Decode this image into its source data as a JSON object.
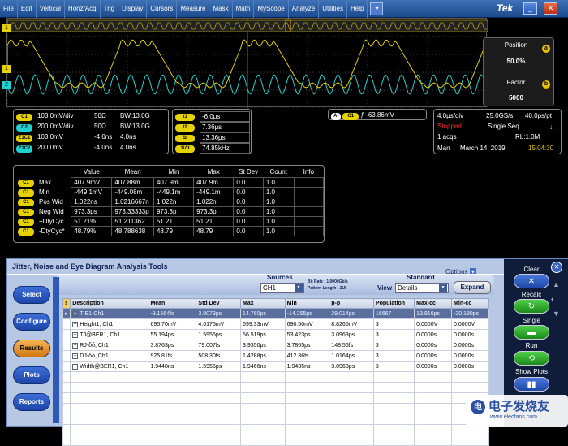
{
  "menu": {
    "items": [
      "File",
      "Edit",
      "Vertical",
      "Horiz/Acq",
      "Trig",
      "Display",
      "Cursors",
      "Measure",
      "Mask",
      "Math",
      "MyScope",
      "Analyze",
      "Utilities",
      "Help"
    ],
    "brand": "Tek"
  },
  "position_panel": {
    "position_label": "Position",
    "position_value": "50.0%",
    "factor_label": "Factor",
    "factor_value": "5000",
    "badge_a": "a",
    "badge_b": "b"
  },
  "channels": [
    {
      "tag": "C1",
      "scale": "103.0mV/div",
      "imp": "50Ω",
      "bw": "BW:13.0G"
    },
    {
      "tag": "C2",
      "scale": "200.0mV/div",
      "imp": "50Ω",
      "bw": "BW:13.0G"
    },
    {
      "tag": "Z1C1",
      "scale": "103.0mV",
      "pos": "-4.0ns",
      "width": "4.0ns"
    },
    {
      "tag": "Z1C2",
      "scale": "200.0mV",
      "pos": "-4.0ns",
      "width": "4.0ns"
    }
  ],
  "cursors": [
    {
      "tag": "t1",
      "value": "-6.0μs"
    },
    {
      "tag": "t2",
      "value": "7.36μs"
    },
    {
      "tag": "Δt",
      "value": "13.36μs"
    },
    {
      "tag": "1/Δt",
      "value": "74.85kHz"
    }
  ],
  "trigger": {
    "tag": "A'",
    "ch": "C1",
    "level": "-63.86mV"
  },
  "acq": {
    "timebase": "4.0μs/div",
    "rate": "25.0GS/s",
    "resolution": "40.0ps/pt",
    "state": "Stopped",
    "mode": "Single Seq",
    "acqs": "1 acqs",
    "rl": "RL:1.0M",
    "day": "Man",
    "date": "March 14, 2019",
    "time": "15:04:30"
  },
  "stats": {
    "headers": [
      "Value",
      "Mean",
      "Min",
      "Max",
      "St Dev",
      "Count",
      "Info"
    ],
    "rows": [
      {
        "ch": "C1",
        "name": "Max",
        "vals": [
          "407.9mV",
          "407.88m",
          "407.9m",
          "407.9m",
          "0.0",
          "1.0",
          ""
        ]
      },
      {
        "ch": "C1",
        "name": "Min",
        "vals": [
          "-449.1mV",
          "-449.08m",
          "-449.1m",
          "-449.1m",
          "0.0",
          "1.0",
          ""
        ]
      },
      {
        "ch": "C1",
        "name": "Pos Wid",
        "vals": [
          "1.022ns",
          "1.0216667n",
          "1.022n",
          "1.022n",
          "0.0",
          "1.0",
          ""
        ]
      },
      {
        "ch": "C1",
        "name": "Neg Wid",
        "vals": [
          "973.3ps",
          "973.33333p",
          "973.3p",
          "973.3p",
          "0.0",
          "1.0",
          ""
        ]
      },
      {
        "ch": "C1",
        "name": "+DtyCyc",
        "vals": [
          "51.21%",
          "51.211362",
          "51.21",
          "51.21",
          "0.0",
          "1.0",
          ""
        ]
      },
      {
        "ch": "C1",
        "name": "-DtyCyc*",
        "vals": [
          "48.79%",
          "48.788638",
          "48.79",
          "48.79",
          "0.0",
          "1.0",
          ""
        ]
      }
    ]
  },
  "jitter": {
    "title": "Jitter, Noise and Eye Diagram Analysis Tools",
    "options": "Options",
    "sources_label": "Sources",
    "source_value": "CH1",
    "bit_rate": "Bit Rate : 1.0000Gb/s",
    "pattern_length": "Pattern Length : 2UI",
    "standard_label": "Standard",
    "view_label": "View",
    "view_value": "Details",
    "expand": "Expand",
    "side_buttons": [
      "Select",
      "Configure",
      "Results",
      "Plots",
      "Reports"
    ],
    "table_headers": [
      "Description",
      "Mean",
      "Std Dev",
      "Max",
      "Min",
      "p-p",
      "Population",
      "Max-cc",
      "Min-cc"
    ],
    "table_rows": [
      [
        "TIE1-Ch1",
        "-9.1564fs",
        "3.9073ps",
        "14.760ps",
        "-14.255ps",
        "29.014ps",
        "16667",
        "13.916ps",
        "-20.180ps"
      ],
      [
        "Height1, Ch1",
        "695.70mV",
        "4.6175mV",
        "699.33mV",
        "690.50mV",
        "8.8265mV",
        "3",
        "0.0000V",
        "0.0000V"
      ],
      [
        "TJ@BER1, Ch1",
        "55.194ps",
        "1.5955ps",
        "56.519ps",
        "53.423ps",
        "3.0963ps",
        "3",
        "0.0000s",
        "0.0000s"
      ],
      [
        "RJ-δδ, Ch1",
        "3.8763ps",
        "79.007fs",
        "3.9350ps",
        "3.7865ps",
        "148.56fs",
        "3",
        "0.0000s",
        "0.0000s"
      ],
      [
        "DJ-δδ, Ch1",
        "925.81fs",
        "508.30fs",
        "1.4288ps",
        "412.36fs",
        "1.0164ps",
        "3",
        "0.0000s",
        "0.0000s"
      ],
      [
        "Width@BER1, Ch1",
        "1.9448ns",
        "1.5955ps",
        "1.9466ns",
        "1.9435ns",
        "3.0963ps",
        "3",
        "0.0000s",
        "0.0000s"
      ]
    ],
    "right_labels": [
      "Clear",
      "Recalc",
      "Single",
      "Run",
      "Show Plots"
    ]
  },
  "watermark": {
    "brand_cn": "电子发烧友",
    "url": "www.elecfans.com"
  }
}
